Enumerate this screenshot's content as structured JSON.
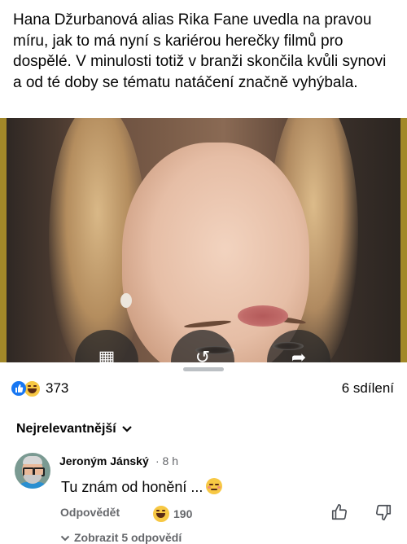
{
  "post": {
    "text": "Hana Džurbanová alias Rika Fane uvedla na pravou míru, jak to má nyní s kariérou herečky filmů pro dospělé. V minulosti totiž v branži skončila kvůli synovi a od té doby se tématu natáčení značně vyhýbala."
  },
  "video_controls": [
    {
      "icon": "clapperboard-icon",
      "glyph": "▦"
    },
    {
      "icon": "replay-icon",
      "glyph": "↺"
    },
    {
      "icon": "share-arrow-icon",
      "glyph": "➦"
    }
  ],
  "stats": {
    "reaction_icons": [
      "like-icon",
      "haha-icon"
    ],
    "reaction_count": "373",
    "shares": "6 sdílení"
  },
  "comments_sort": {
    "label": "Nejrelevantnější"
  },
  "comment": {
    "author": "Jeroným Jánský",
    "time": "· 8 h",
    "text": "Tu znám od honění ...",
    "reply_label": "Odpovědět",
    "reaction_count": "190",
    "view_replies": "Zobrazit 5 odpovědí"
  },
  "colors": {
    "like_blue": "#1877f2",
    "secondary_text": "#65676b",
    "primary_text": "#050505"
  }
}
